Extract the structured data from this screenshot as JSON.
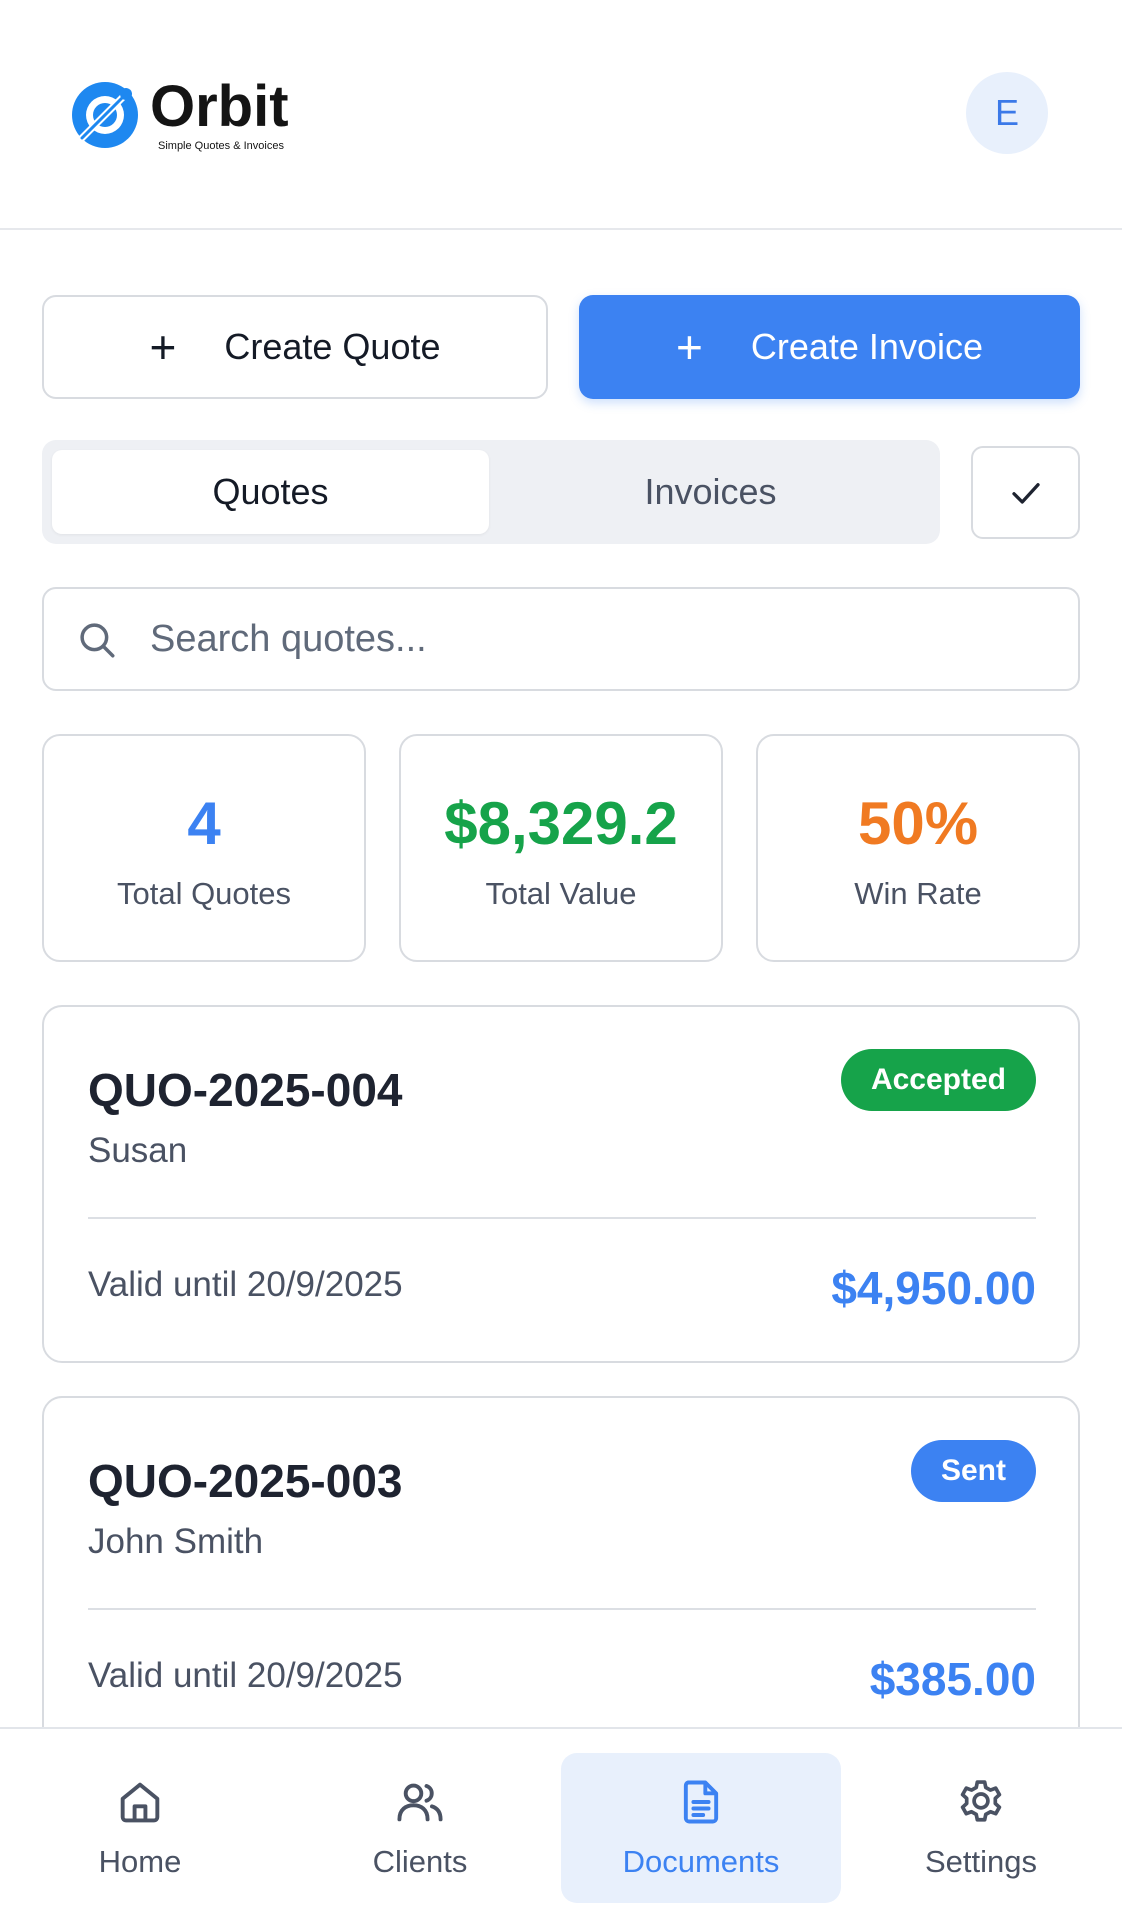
{
  "brand": {
    "name": "Orbit",
    "tagline": "Simple Quotes & Invoices",
    "avatar_initial": "E",
    "accent_color": "#3c82f2"
  },
  "actions": {
    "create_quote": "Create Quote",
    "create_invoice": "Create Invoice",
    "plus_symbol": "+"
  },
  "tabs": [
    {
      "label": "Quotes",
      "active": true
    },
    {
      "label": "Invoices",
      "active": false
    }
  ],
  "search": {
    "placeholder": "Search quotes...",
    "value": ""
  },
  "stats": [
    {
      "value": "4",
      "label": "Total Quotes",
      "color": "#3c82f2"
    },
    {
      "value": "$8,329.2",
      "label": "Total Value",
      "color": "#16a34a"
    },
    {
      "value": "50%",
      "label": "Win Rate",
      "color": "#f07a22"
    }
  ],
  "quotes": [
    {
      "number": "QUO-2025-004",
      "client": "Susan",
      "status": "Accepted",
      "status_color": "#16a34a",
      "valid": "Valid until 20/9/2025",
      "amount": "$4,950.00"
    },
    {
      "number": "QUO-2025-003",
      "client": "John Smith",
      "status": "Sent",
      "status_color": "#3c82f2",
      "valid": "Valid until 20/9/2025",
      "amount": "$385.00"
    }
  ],
  "nav": [
    {
      "label": "Home",
      "icon": "home-icon",
      "active": false
    },
    {
      "label": "Clients",
      "icon": "users-icon",
      "active": false
    },
    {
      "label": "Documents",
      "icon": "document-icon",
      "active": true
    },
    {
      "label": "Settings",
      "icon": "gear-icon",
      "active": false
    }
  ]
}
